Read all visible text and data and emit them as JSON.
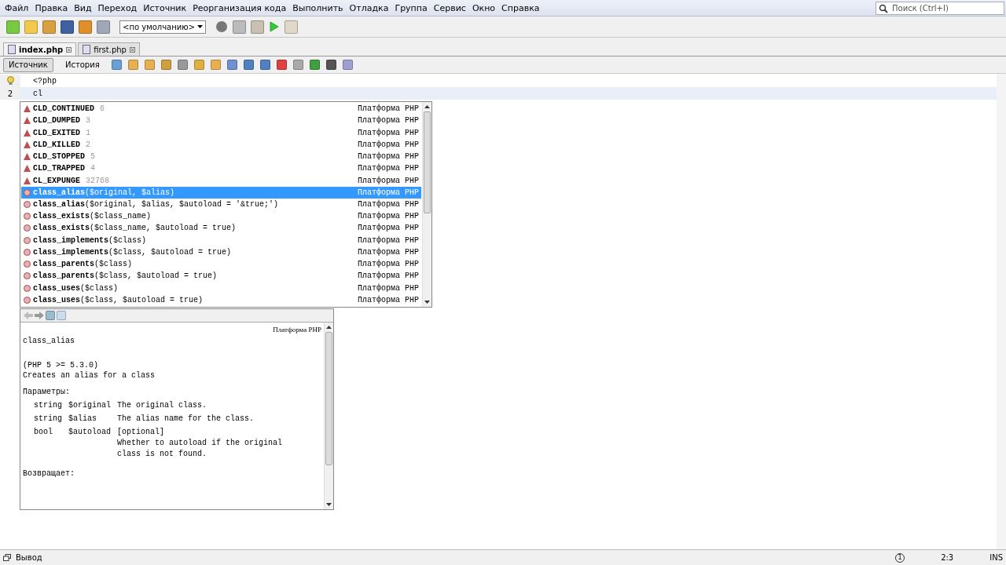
{
  "menu": [
    "Файл",
    "Правка",
    "Вид",
    "Переход",
    "Источник",
    "Реорганизация кода",
    "Выполнить",
    "Отладка",
    "Группа",
    "Сервис",
    "Окно",
    "Справка"
  ],
  "search": {
    "placeholder": "Поиск (Ctrl+I)"
  },
  "config": {
    "value": "<по умолчанию>"
  },
  "file_tabs": [
    {
      "label": "index.php",
      "selected": true
    },
    {
      "label": "first.php",
      "selected": false
    }
  ],
  "view_tabs": [
    {
      "label": "Источник",
      "selected": true
    },
    {
      "label": "История",
      "selected": false
    }
  ],
  "lines": [
    {
      "kind": "hint",
      "text": "<?php",
      "current": false
    },
    {
      "kind": "number",
      "number": "2",
      "text": "cl",
      "current": true
    }
  ],
  "completion": [
    {
      "kind": "constant",
      "name": "CLD_CONTINUED",
      "value": "6",
      "source": "Платформа PHP",
      "selected": false
    },
    {
      "kind": "constant",
      "name": "CLD_DUMPED",
      "value": "3",
      "source": "Платформа PHP",
      "selected": false
    },
    {
      "kind": "constant",
      "name": "CLD_EXITED",
      "value": "1",
      "source": "Платформа PHP",
      "selected": false
    },
    {
      "kind": "constant",
      "name": "CLD_KILLED",
      "value": "2",
      "source": "Платформа PHP",
      "selected": false
    },
    {
      "kind": "constant",
      "name": "CLD_STOPPED",
      "value": "5",
      "source": "Платформа PHP",
      "selected": false
    },
    {
      "kind": "constant",
      "name": "CLD_TRAPPED",
      "value": "4",
      "source": "Платформа PHP",
      "selected": false
    },
    {
      "kind": "constant",
      "name": "CL_EXPUNGE",
      "value": "32768",
      "source": "Платформа PHP",
      "selected": false
    },
    {
      "kind": "function",
      "name": "class_alias",
      "value": "($original, $alias)",
      "source": "Платформа PHP",
      "selected": true
    },
    {
      "kind": "function",
      "name": "class_alias",
      "value": "($original, $alias, $autoload = '&true;')",
      "source": "Платформа PHP",
      "selected": false
    },
    {
      "kind": "function",
      "name": "class_exists",
      "value": "($class_name)",
      "source": "Платформа PHP",
      "selected": false
    },
    {
      "kind": "function",
      "name": "class_exists",
      "value": "($class_name, $autoload = true)",
      "source": "Платформа PHP",
      "selected": false
    },
    {
      "kind": "function",
      "name": "class_implements",
      "value": "($class)",
      "source": "Платформа PHP",
      "selected": false
    },
    {
      "kind": "function",
      "name": "class_implements",
      "value": "($class, $autoload = true)",
      "source": "Платформа PHP",
      "selected": false
    },
    {
      "kind": "function",
      "name": "class_parents",
      "value": "($class)",
      "source": "Платформа PHP",
      "selected": false
    },
    {
      "kind": "function",
      "name": "class_parents",
      "value": "($class, $autoload = true)",
      "source": "Платформа PHP",
      "selected": false
    },
    {
      "kind": "function",
      "name": "class_uses",
      "value": "($class)",
      "source": "Платформа PHP",
      "selected": false
    },
    {
      "kind": "function",
      "name": "class_uses",
      "value": "($class, $autoload = true)",
      "source": "Платформа PHP",
      "selected": false
    }
  ],
  "doc": {
    "source": "Платформа PHP",
    "title": "class_alias",
    "version": "(PHP 5 >= 5.3.0)",
    "description": "Creates an alias for a class",
    "params_heading": "Параметры:",
    "params": [
      {
        "type": "string",
        "name": "$original",
        "desc": [
          "The original class."
        ]
      },
      {
        "type": "string",
        "name": "$alias",
        "desc": [
          "The alias name for the class."
        ]
      },
      {
        "type": "bool",
        "name": "$autoload",
        "desc": [
          "[optional]",
          "Whether to autoload if the original",
          "class is not found."
        ]
      }
    ],
    "returns_heading": "Возвращает:"
  },
  "status_bar": {
    "output": "Вывод",
    "notifications": "1",
    "position": "2:3",
    "mode": "INS"
  }
}
